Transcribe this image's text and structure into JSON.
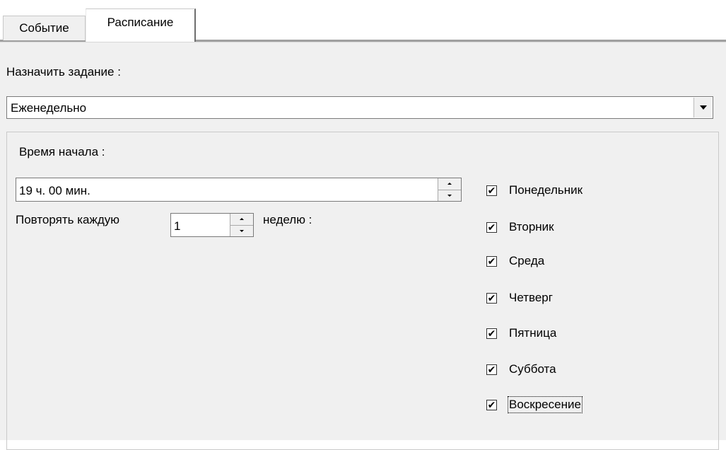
{
  "tabs": [
    {
      "label": "Событие"
    },
    {
      "label": "Расписание"
    }
  ],
  "assign_label": "Назначить задание :",
  "frequency": {
    "value": "Еженедельно"
  },
  "start_time": {
    "label": "Время начала :",
    "value": "19 ч. 00 мин."
  },
  "repeat": {
    "prefix": "Повторять  каждую",
    "value": "1",
    "suffix": "неделю :"
  },
  "days": [
    {
      "label": "Понедельник",
      "checked": true
    },
    {
      "label": "Вторник",
      "checked": true
    },
    {
      "label": "Среда",
      "checked": true
    },
    {
      "label": "Четверг",
      "checked": true
    },
    {
      "label": "Пятница",
      "checked": true
    },
    {
      "label": "Суббота",
      "checked": true
    },
    {
      "label": "Воскресение",
      "checked": true
    }
  ],
  "check_glyph": "✔"
}
